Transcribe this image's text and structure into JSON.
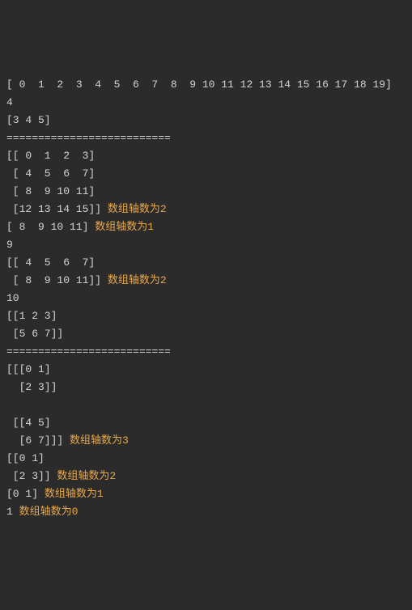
{
  "lines": [
    {
      "text": "[ 0  1  2  3  4  5  6  7  8  9 10 11 12 13 14 15 16 17 18 19]",
      "suffix": null
    },
    {
      "text": "4",
      "suffix": null
    },
    {
      "text": "[3 4 5]",
      "suffix": null
    },
    {
      "text": "==========================",
      "suffix": null
    },
    {
      "text": "[[ 0  1  2  3]",
      "suffix": null
    },
    {
      "text": " [ 4  5  6  7]",
      "suffix": null
    },
    {
      "text": " [ 8  9 10 11]",
      "suffix": null
    },
    {
      "text": " [12 13 14 15]] ",
      "suffix": "数组轴数为2"
    },
    {
      "text": "[ 8  9 10 11] ",
      "suffix": "数组轴数为1"
    },
    {
      "text": "9",
      "suffix": null
    },
    {
      "text": "[[ 4  5  6  7]",
      "suffix": null
    },
    {
      "text": " [ 8  9 10 11]] ",
      "suffix": "数组轴数为2"
    },
    {
      "text": "10",
      "suffix": null
    },
    {
      "text": "[[1 2 3]",
      "suffix": null
    },
    {
      "text": " [5 6 7]]",
      "suffix": null
    },
    {
      "text": "==========================",
      "suffix": null
    },
    {
      "text": "[[[0 1]",
      "suffix": null
    },
    {
      "text": "  [2 3]]",
      "suffix": null
    },
    {
      "text": " ",
      "suffix": null
    },
    {
      "text": " [[4 5]",
      "suffix": null
    },
    {
      "text": "  [6 7]]] ",
      "suffix": "数组轴数为3"
    },
    {
      "text": "[[0 1]",
      "suffix": null
    },
    {
      "text": " [2 3]] ",
      "suffix": "数组轴数为2"
    },
    {
      "text": "[0 1] ",
      "suffix": "数组轴数为1"
    },
    {
      "text": "1 ",
      "suffix": "数组轴数为0"
    }
  ]
}
